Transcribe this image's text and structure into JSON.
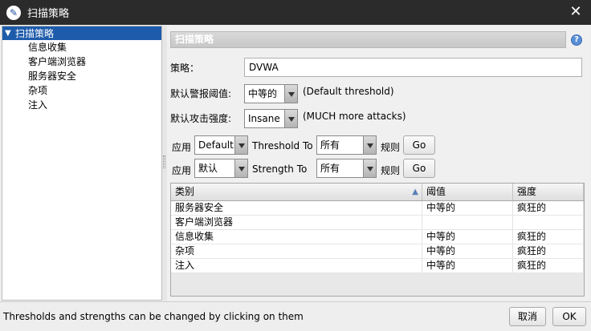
{
  "window": {
    "title": "扫描策略",
    "close_glyph": "✕"
  },
  "tree": {
    "root_toggle": "▼",
    "root_label": "扫描策略",
    "items": [
      "信息收集",
      "客户端浏览器",
      "服务器安全",
      "杂项",
      "注入"
    ]
  },
  "header": {
    "title": "扫描策略",
    "help_glyph": "?"
  },
  "form": {
    "policy_label": "策略：",
    "policy_value": "DVWA",
    "threshold_label": "默认警报阈值:",
    "threshold_value": "中等的",
    "threshold_note": "(Default threshold)",
    "strength_label": "默认攻击强度:",
    "strength_value": "Insane",
    "strength_note": "(MUCH more attacks)"
  },
  "apply_threshold": {
    "apply_label": "应用",
    "level_value": "Default",
    "to_label": "Threshold To",
    "scope_value": "所有",
    "rules_label": "规则",
    "go_label": "Go"
  },
  "apply_strength": {
    "apply_label": "应用",
    "level_value": "默认",
    "to_label": "Strength To",
    "scope_value": "所有",
    "rules_label": "规则",
    "go_label": "Go"
  },
  "table": {
    "columns": [
      "类别",
      "阈值",
      "强度"
    ],
    "sort_glyph": "▲",
    "rows": [
      {
        "category": "服务器安全",
        "threshold": "中等的",
        "strength": "疯狂的"
      },
      {
        "category": "客户端浏览器",
        "threshold": "",
        "strength": ""
      },
      {
        "category": "信息收集",
        "threshold": "中等的",
        "strength": "疯狂的"
      },
      {
        "category": "杂项",
        "threshold": "中等的",
        "strength": "疯狂的"
      },
      {
        "category": "注入",
        "threshold": "中等的",
        "strength": "疯狂的"
      }
    ]
  },
  "footer": {
    "status_text": "Thresholds and strengths can be changed by clicking on them",
    "cancel_label": "取消",
    "ok_label": "OK"
  }
}
